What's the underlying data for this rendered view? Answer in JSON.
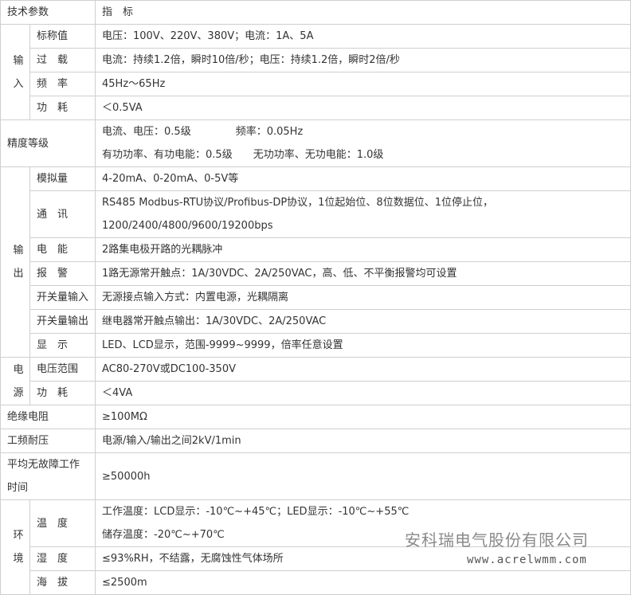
{
  "header": {
    "param": "技术参数",
    "spec": "指　标"
  },
  "input": {
    "cat1": "输",
    "cat2": "入",
    "rated_label": "标称值",
    "rated": "电压：100V、220V、380V；电流：1A、5A",
    "overload_label": "过　载",
    "overload": "电流：持续1.2倍，瞬时10倍/秒；电压：持续1.2倍，瞬时2倍/秒",
    "freq_label": "频　率",
    "freq": "45Hz～65Hz",
    "power_label": "功　耗",
    "power": "＜0.5VA"
  },
  "accuracy": {
    "label": "精度等级",
    "line1a": "电流、电压：0.5级",
    "line1b": "频率：0.05Hz",
    "line2a": "有功功率、有功电能：0.5级",
    "line2b": "无功功率、无功电能：1.0级"
  },
  "output": {
    "cat1": "输",
    "cat2": "出",
    "analog_label": "模拟量",
    "analog": "4-20mA、0-20mA、0-5V等",
    "comm_label": "通　讯",
    "comm_line1": "RS485  Modbus-RTU协议/Profibus-DP协议，1位起始位、8位数据位、1位停止位，",
    "comm_line2": "1200/2400/4800/9600/19200bps",
    "energy_label": "电　能",
    "energy": "2路集电极开路的光耦脉冲",
    "alarm_label": "报　警",
    "alarm": "1路无源常开触点：1A/30VDC、2A/250VAC，高、低、不平衡报警均可设置",
    "di_label": "开关量输入",
    "di": "无源接点输入方式：内置电源，光耦隔离",
    "do_label": "开关量输出",
    "do": "继电器常开触点输出：1A/30VDC、2A/250VAC",
    "display_label": "显　示",
    "display": "LED、LCD显示，范围-9999~9999，倍率任意设置"
  },
  "supply": {
    "cat1": "电",
    "cat2": "源",
    "range_label": "电压范围",
    "range": "AC80-270V或DC100-350V",
    "power_label": "功　耗",
    "power": "＜4VA"
  },
  "insulation": {
    "label": "绝缘电阻",
    "value": "≥100MΩ"
  },
  "withstand": {
    "label": "工频耐压",
    "value": "电源/输入/输出之间2kV/1min"
  },
  "mtbf": {
    "label1": "平均无故障工作",
    "label2": "时间",
    "value": "≥50000h"
  },
  "env": {
    "cat1": "环",
    "cat2": "境",
    "temp_label": "温　度",
    "temp_line1": "工作温度：LCD显示：-10℃~+45℃；LED显示：-10℃~+55℃",
    "temp_line2": "储存温度：-20℃~+70℃",
    "humidity_label": "湿　度",
    "humidity": "≤93%RH，不结露，无腐蚀性气体场所",
    "altitude_label": "海　拔",
    "altitude": "≤2500m"
  },
  "watermark": {
    "company": "安科瑞电气股份有限公司",
    "url": "www.acrelwmm.com"
  }
}
